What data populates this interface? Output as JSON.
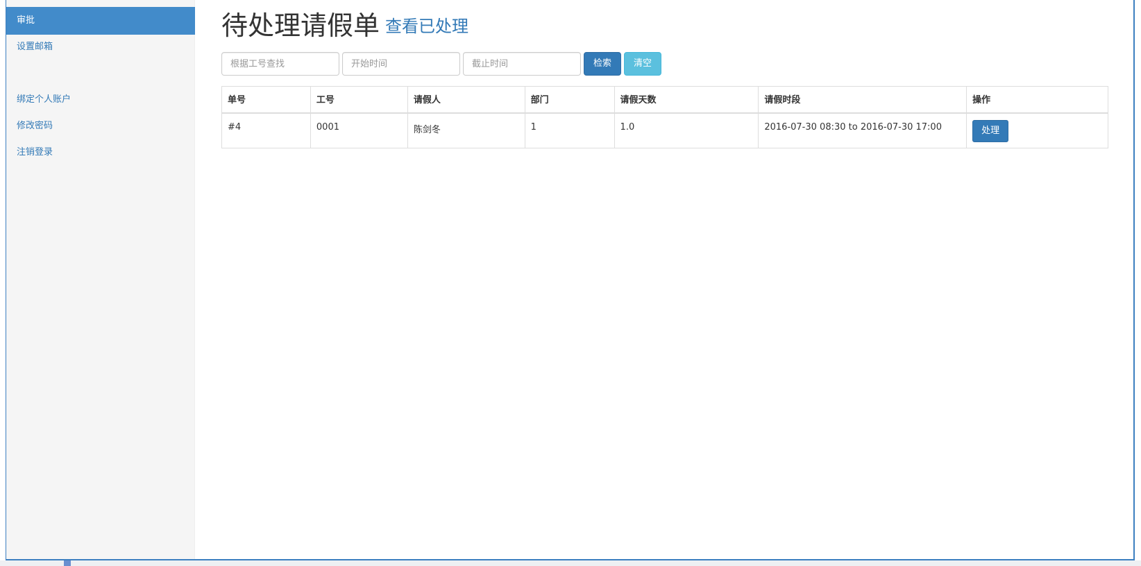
{
  "sidebar": {
    "items": [
      {
        "label": "审批",
        "active": true
      },
      {
        "label": "设置邮箱",
        "active": false
      },
      {
        "label": "绑定个人账户",
        "active": false
      },
      {
        "label": "修改密码",
        "active": false
      },
      {
        "label": "注销登录",
        "active": false
      }
    ]
  },
  "header": {
    "title": "待处理请假单",
    "processed_link": "查看已处理"
  },
  "filters": {
    "employee_id_placeholder": "根据工号查找",
    "start_time_placeholder": "开始时间",
    "end_time_placeholder": "截止时间",
    "search_label": "检索",
    "clear_label": "清空"
  },
  "table": {
    "columns": [
      "单号",
      "工号",
      "请假人",
      "部门",
      "请假天数",
      "请假时段",
      "操作"
    ],
    "rows": [
      {
        "order_no": "#4",
        "employee_id": "0001",
        "name": "陈剑冬",
        "department": "1",
        "days": "1.0",
        "period": "2016-07-30 08:30 to 2016-07-30 17:00",
        "action": "处理"
      }
    ]
  },
  "colors": {
    "primary": "#337ab7",
    "active_nav": "#428bca",
    "info": "#5bc0de"
  }
}
